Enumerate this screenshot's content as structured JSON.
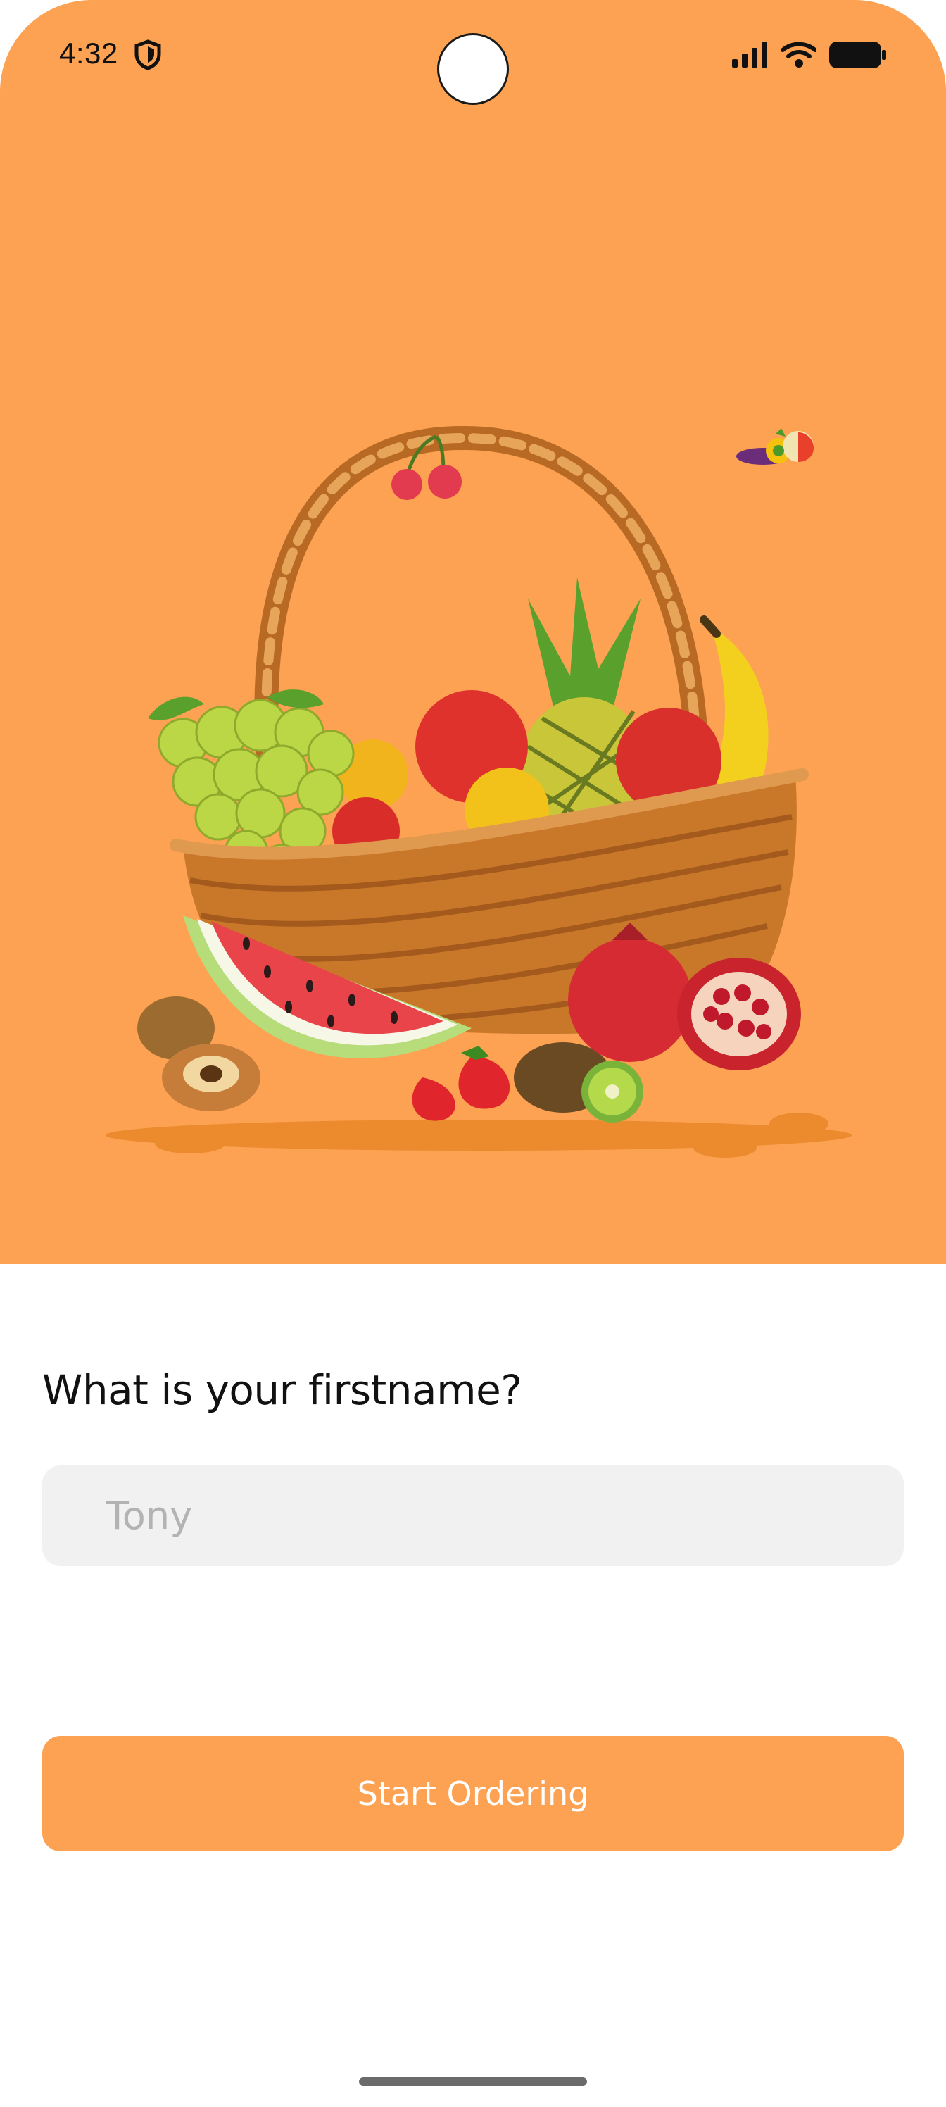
{
  "status_bar": {
    "time": "4:32"
  },
  "icons": {
    "shield": "shield-icon",
    "signal": "signal-icon",
    "wifi": "wifi-icon",
    "battery": "battery-icon",
    "basket": "fruit-basket-illustration",
    "mini_fruit": "fruit-icon"
  },
  "colors": {
    "accent": "#fca252",
    "input_bg": "#f2f1f2",
    "text": "#111111"
  },
  "form": {
    "question": "What is your firstname?",
    "name_placeholder": "Tony",
    "name_value": ""
  },
  "actions": {
    "start_label": "Start Ordering"
  }
}
